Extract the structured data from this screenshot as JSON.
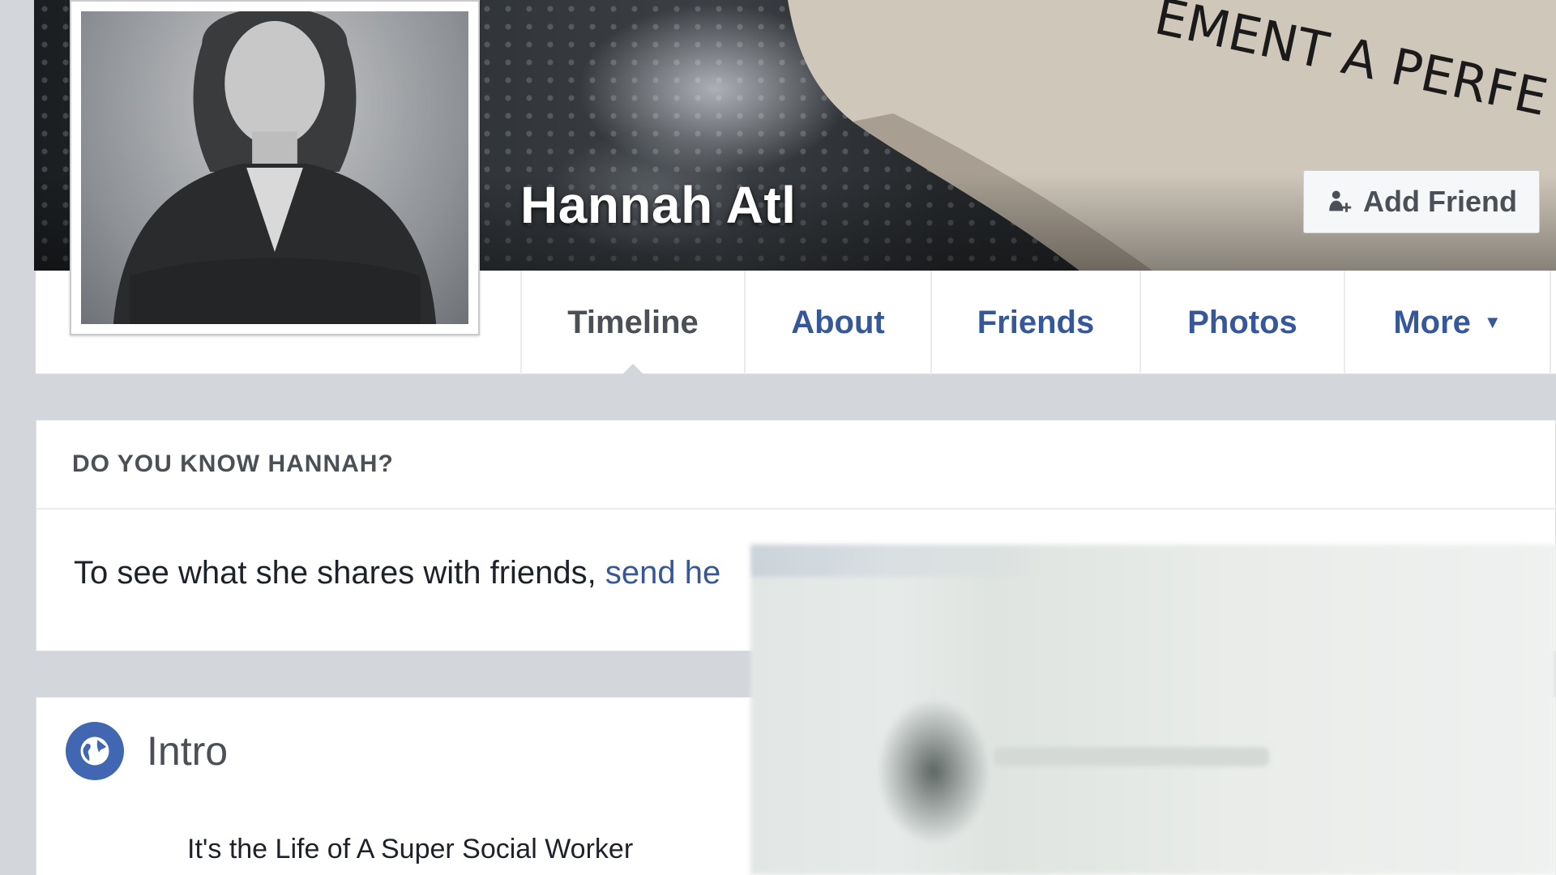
{
  "profile": {
    "name": "Hannah Atl",
    "add_friend_label": "Add Friend",
    "cover_text": "EMENT A PERFE"
  },
  "tabs": [
    {
      "label": "Timeline",
      "active": true
    },
    {
      "label": "About",
      "active": false
    },
    {
      "label": "Friends",
      "active": false
    },
    {
      "label": "Photos",
      "active": false
    },
    {
      "label": "More",
      "active": false
    }
  ],
  "know_card": {
    "heading": "DO YOU KNOW HANNAH?",
    "text": "To see what she shares with friends, ",
    "link_text": "send he"
  },
  "intro": {
    "title": "Intro",
    "bio": "It's the Life of A Super Social Worker"
  },
  "colors": {
    "link_blue": "#365899",
    "globe_blue": "#4267b2",
    "page_bg": "#d3d6db"
  },
  "icons": [
    "add-friend-icon",
    "chevron-down-icon",
    "globe-icon"
  ]
}
